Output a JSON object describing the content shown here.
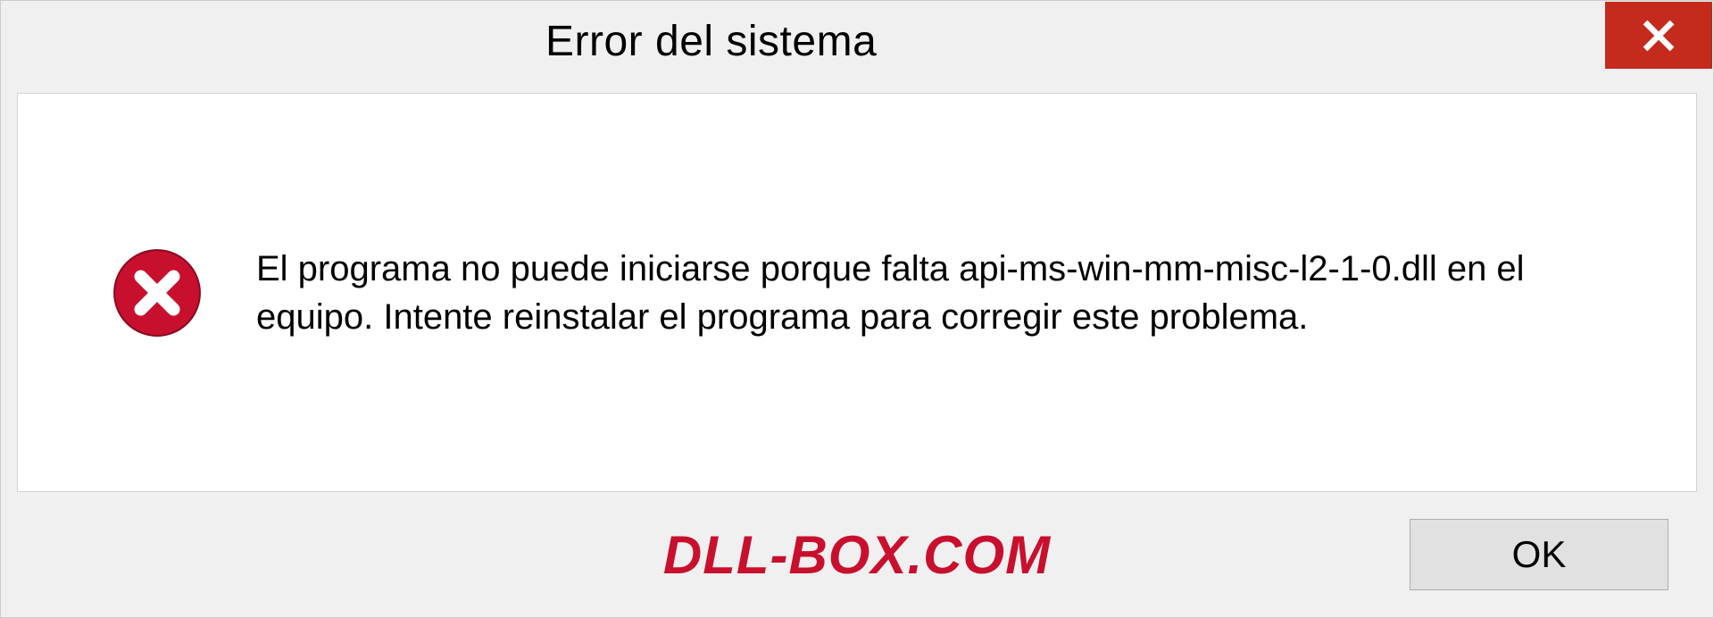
{
  "dialog": {
    "title": "Error del sistema",
    "message": "El programa no puede iniciarse porque falta api-ms-win-mm-misc-l2-1-0.dll en el equipo. Intente reinstalar el programa para corregir este problema.",
    "ok_label": "OK"
  },
  "watermark": "DLL-BOX.COM",
  "colors": {
    "close_bg": "#c42b1c",
    "error_circle": "#c8102e",
    "watermark": "#c8102e"
  }
}
